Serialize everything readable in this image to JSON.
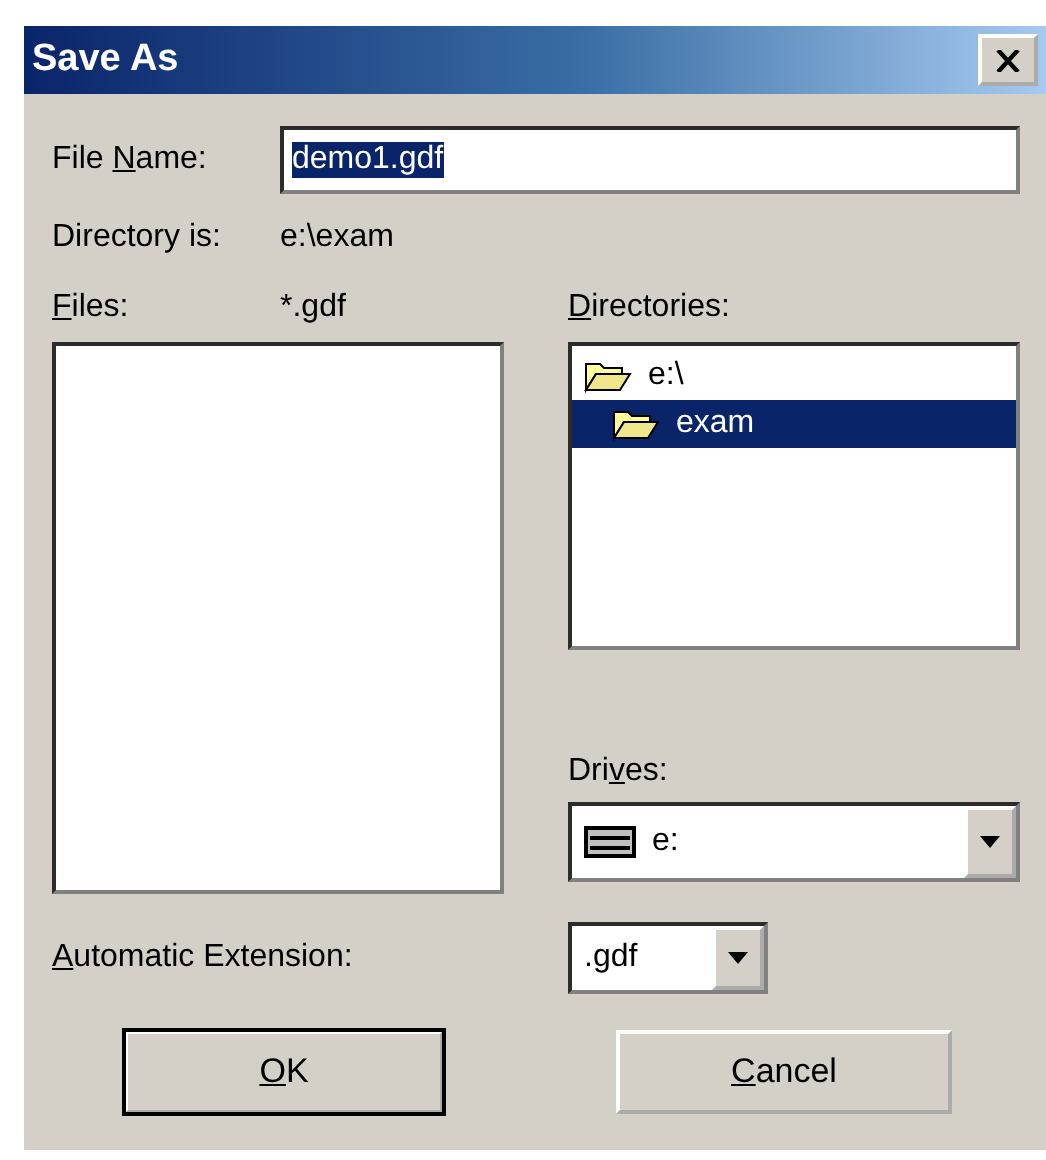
{
  "window": {
    "title": "Save As"
  },
  "file_name": {
    "label": {
      "pre": "File ",
      "key": "N",
      "rest": "ame:"
    },
    "value": "demo1.gdf",
    "selected_text": true
  },
  "directory": {
    "label": "Directory is:",
    "value": "e:\\exam"
  },
  "files": {
    "label": {
      "key": "F",
      "rest": "iles:"
    },
    "filter": "*.gdf"
  },
  "directories": {
    "label": {
      "key": "D",
      "rest": "irectories:"
    },
    "items": [
      {
        "name": "e:\\",
        "selected": false,
        "children": [
          {
            "name": "exam",
            "selected": true
          }
        ]
      }
    ]
  },
  "drives": {
    "label": {
      "pre": "Dri",
      "key": "v",
      "rest": "es:"
    },
    "value": "e:"
  },
  "extension": {
    "label": {
      "key": "A",
      "rest": "utomatic Extension:"
    },
    "value": ".gdf"
  },
  "buttons": [
    {
      "label": {
        "key": "O",
        "rest": "K"
      },
      "default": true
    },
    {
      "label": {
        "key": "C",
        "rest": "ancel"
      },
      "default": false
    }
  ]
}
